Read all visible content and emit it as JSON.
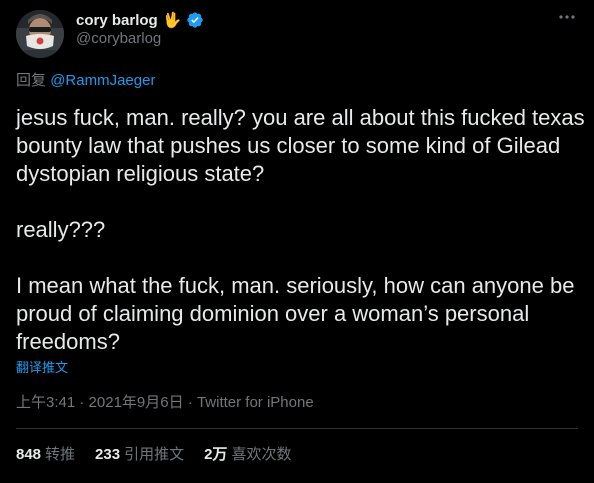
{
  "author": {
    "display_name": "cory barlog",
    "name_emoji": "🖖",
    "handle": "@corybarlog",
    "verified": true
  },
  "reply": {
    "prefix": "回复",
    "mention": "@RammJaeger"
  },
  "tweet": {
    "paragraphs": [
      "jesus fuck, man. really? you are all about this fucked texas bounty law that pushes us closer to some kind of Gilead dystopian religious state?",
      "really???",
      "I mean what the fuck, man. seriously, how can anyone be proud of claiming dominion over a woman’s personal freedoms?"
    ],
    "translate_label": "翻译推文"
  },
  "meta": {
    "time": "上午3:41",
    "separator": "·",
    "date": "2021年9月6日",
    "source": "Twitter for iPhone"
  },
  "stats": {
    "retweets_count": "848",
    "retweets_label": "转推",
    "quotes_count": "233",
    "quotes_label": "引用推文",
    "likes_count": "2万",
    "likes_label": "喜欢次数"
  },
  "colors": {
    "background": "#000000",
    "text": "#e7e9ea",
    "muted": "#71767b",
    "accent": "#1d9bf0"
  },
  "icons": {
    "verified": "verified-badge-icon",
    "more": "more-dots-icon"
  }
}
